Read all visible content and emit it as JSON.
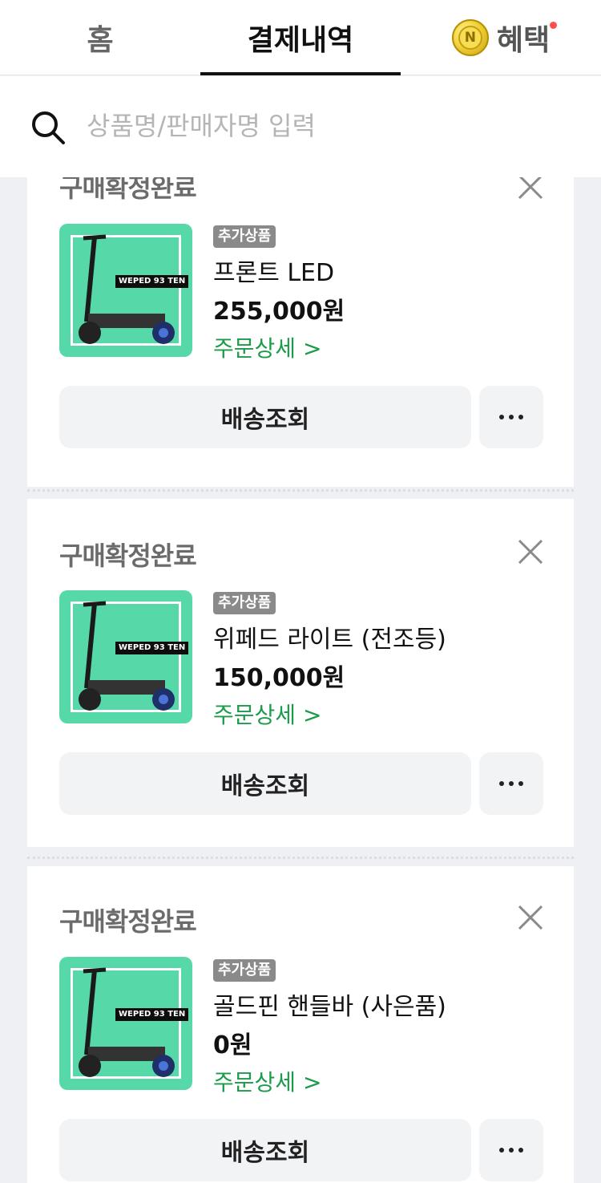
{
  "tabs": {
    "home": "홈",
    "payments": "결제내역",
    "benefits": "혜택",
    "coin_letter": "N"
  },
  "search": {
    "placeholder": "상품명/판매자명 입력",
    "icon": "search-icon"
  },
  "orders": [
    {
      "status": "구매확정완료",
      "badge": "추가상품",
      "product_name": "프론트 LED",
      "price": "255,000원",
      "detail_link": "주문상세 >",
      "track_button": "배송조회",
      "thumb_brand": "WEPED 93 TEN"
    },
    {
      "status": "구매확정완료",
      "badge": "추가상품",
      "product_name": "위페드 라이트 (전조등)",
      "price": "150,000원",
      "detail_link": "주문상세 >",
      "track_button": "배송조회",
      "thumb_brand": "WEPED 93 TEN"
    },
    {
      "status": "구매확정완료",
      "badge": "추가상품",
      "product_name": "골드핀 핸들바 (사은품)",
      "price": "0원",
      "detail_link": "주문상세 >",
      "track_button": "배송조회",
      "thumb_brand": "WEPED 93 TEN"
    }
  ],
  "colors": {
    "accent_green": "#1c9b4a",
    "thumb_bg": "#57d8a9",
    "notification_dot": "#ff4d4d"
  }
}
